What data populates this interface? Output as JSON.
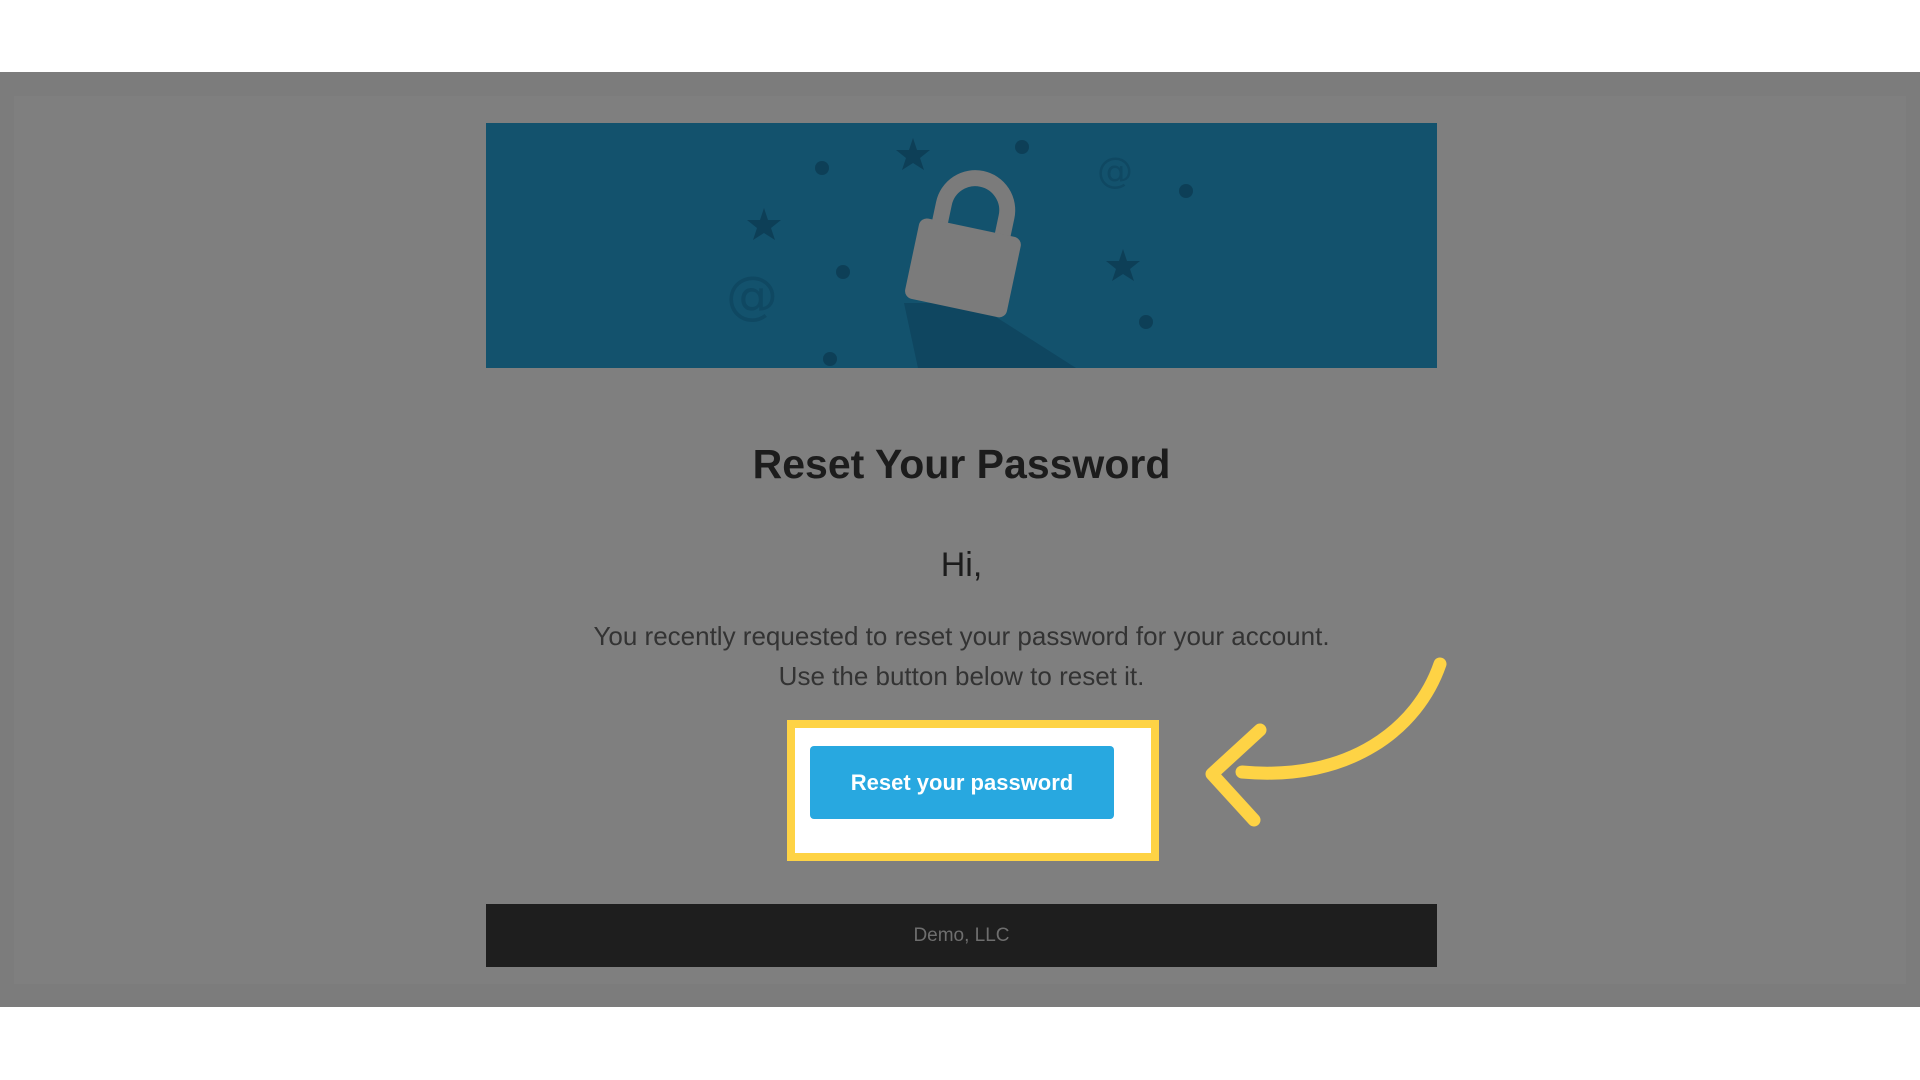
{
  "email": {
    "title": "Reset Your Password",
    "greeting": "Hi,",
    "body_line_1": "You recently requested to reset your password for your account.",
    "body_line_2": "Use the button below to reset it.",
    "button_label": "Reset your password",
    "footer": "Demo, LLC"
  },
  "banner": {
    "background_color": "#13526d",
    "icons": [
      "lock-icon",
      "star-icon",
      "at-sign-icon",
      "dot-icon"
    ]
  },
  "colors": {
    "accent": "#28a8e0",
    "highlight": "#fed345",
    "overlay": "#7f7f7f",
    "footer": "#1e1e1e"
  }
}
